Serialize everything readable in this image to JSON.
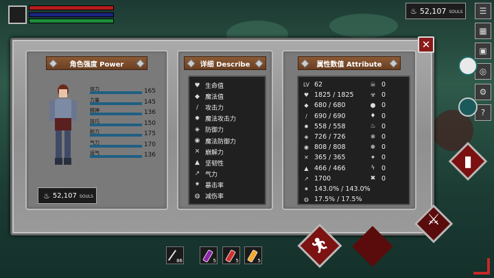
{
  "hud": {
    "souls_top": {
      "value": "52,107",
      "unit": "SOULS"
    }
  },
  "power": {
    "title": "角色强度 Power",
    "stats": [
      {
        "label": "体力",
        "value": "165"
      },
      {
        "label": "力量",
        "value": "145"
      },
      {
        "label": "精神",
        "value": "136"
      },
      {
        "label": "技巧",
        "value": "150"
      },
      {
        "label": "耐力",
        "value": "175"
      },
      {
        "label": "气力",
        "value": "170"
      },
      {
        "label": "运气",
        "value": "136"
      }
    ],
    "souls": {
      "value": "52,107",
      "unit": "SOULS"
    }
  },
  "describe": {
    "title": "详细 Describe",
    "items": [
      "生命值",
      "魔法值",
      "攻击力",
      "魔法攻击力",
      "防御力",
      "魔法防御力",
      "崩解力",
      "坚韧性",
      "气力",
      "暴击率",
      "减伤率"
    ]
  },
  "attribute": {
    "title": "属性数值 Attribute",
    "rows": [
      {
        "icon": "lv-icon",
        "glyph": "LV",
        "value": "62"
      },
      {
        "icon": "heart-icon",
        "glyph": "♥",
        "value": "1825 / 1825"
      },
      {
        "icon": "mana-icon",
        "glyph": "◆",
        "value": "680 / 680"
      },
      {
        "icon": "sword-icon",
        "glyph": "/",
        "value": "690 / 690"
      },
      {
        "icon": "magic-attack-icon",
        "glyph": "✹",
        "value": "558 / 558"
      },
      {
        "icon": "shield-icon",
        "glyph": "◈",
        "value": "726 / 726"
      },
      {
        "icon": "magic-defense-icon",
        "glyph": "◉",
        "value": "808 / 808"
      },
      {
        "icon": "break-icon",
        "glyph": "✕",
        "value": "365 / 365"
      },
      {
        "icon": "toughness-icon",
        "glyph": "▲",
        "value": "466 / 466"
      },
      {
        "icon": "stamina-icon",
        "glyph": "↗",
        "value": "1700"
      },
      {
        "icon": "crit-icon",
        "glyph": "✷",
        "value": "143.0% / 143.0%"
      },
      {
        "icon": "reduction-icon",
        "glyph": "◍",
        "value": "17.5% / 17.5%"
      }
    ],
    "resistances": [
      {
        "icon": "skull-icon",
        "glyph": "☠",
        "value": "0"
      },
      {
        "icon": "poison-icon",
        "glyph": "☣",
        "value": "0"
      },
      {
        "icon": "bleed-icon",
        "glyph": "●",
        "value": "0"
      },
      {
        "icon": "drop-icon",
        "glyph": "♦",
        "value": "0"
      },
      {
        "icon": "fire-icon",
        "glyph": "♨",
        "value": "0"
      },
      {
        "icon": "frost-icon",
        "glyph": "❄",
        "value": "0"
      },
      {
        "icon": "frost-icon",
        "glyph": "❅",
        "value": "0"
      },
      {
        "icon": "holy-icon",
        "glyph": "✦",
        "value": "0"
      },
      {
        "icon": "lightning-icon",
        "glyph": "ϟ",
        "value": "0"
      },
      {
        "icon": "dark-icon",
        "glyph": "✖",
        "value": "0"
      }
    ]
  },
  "hotbar": {
    "slots": [
      {
        "name": "arrow-slot",
        "count": "86",
        "color": "#e0e0e0"
      },
      {
        "name": "purple-potion-slot",
        "count": "5",
        "color": "#8e24aa"
      },
      {
        "name": "red-potion-slot",
        "count": "5",
        "color": "#d32f2f"
      },
      {
        "name": "yellow-potion-slot",
        "count": "5",
        "color": "#f9a825"
      }
    ]
  },
  "colors": {
    "accent_red": "#7c1212",
    "bar_hp": "#b71c1c",
    "bar_mp": "#1a237e",
    "bar_sp": "#1b8e3a"
  }
}
